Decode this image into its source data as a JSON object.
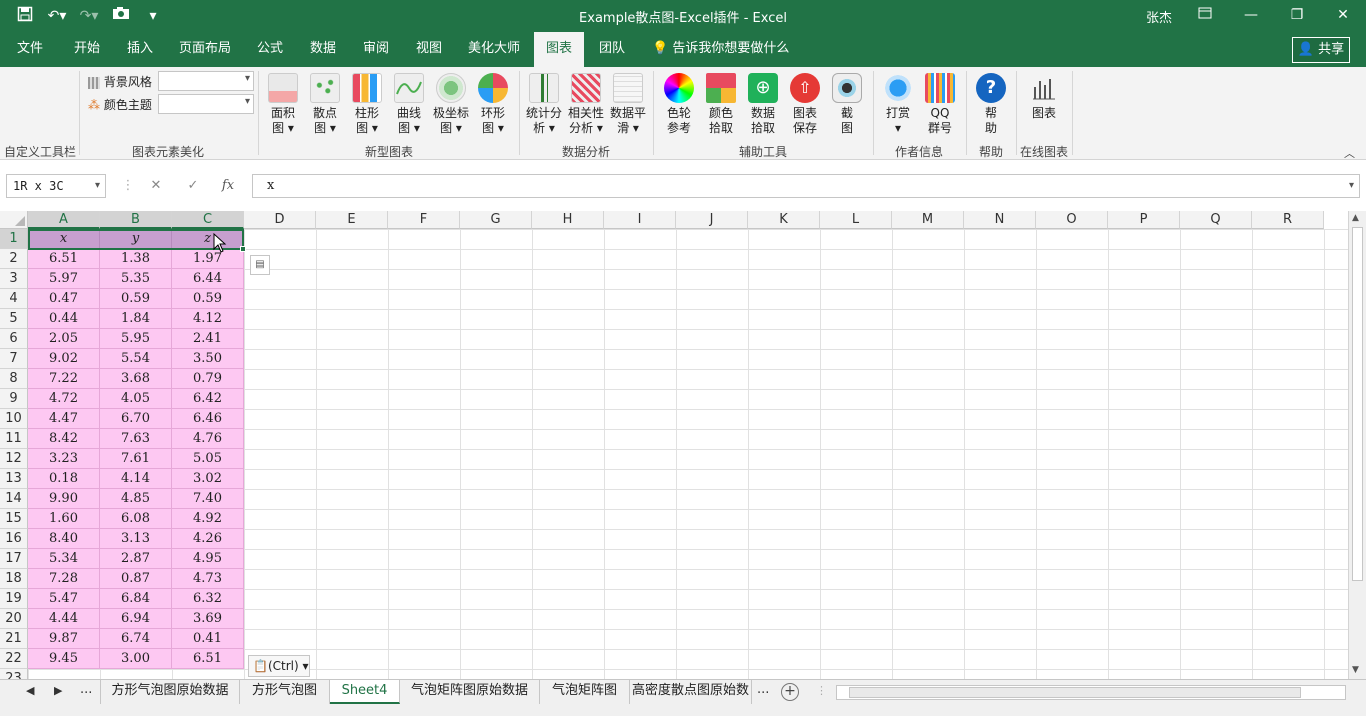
{
  "titlebar": {
    "title": "Example散点图-Excel插件 - Excel",
    "user": "张杰",
    "qat_icons": [
      "save-icon",
      "undo-icon",
      "redo-icon",
      "camera-icon",
      "customize-icon"
    ]
  },
  "tabs": [
    {
      "label": "文件",
      "active": false
    },
    {
      "label": "开始",
      "active": false
    },
    {
      "label": "插入",
      "active": false
    },
    {
      "label": "页面布局",
      "active": false
    },
    {
      "label": "公式",
      "active": false
    },
    {
      "label": "数据",
      "active": false
    },
    {
      "label": "审阅",
      "active": false
    },
    {
      "label": "视图",
      "active": false
    },
    {
      "label": "美化大师",
      "active": false
    },
    {
      "label": "图表",
      "active": true
    },
    {
      "label": "团队",
      "active": false
    }
  ],
  "tell_me": "告诉我你想要做什么",
  "share_label": "共享",
  "ribbon": {
    "groups": {
      "custom_toolbar": "自定义工具栏",
      "beautify": "图表元素美化",
      "new_chart": "新型图表",
      "analysis": "数据分析",
      "assist": "辅助工具",
      "author": "作者信息",
      "help": "帮助",
      "online": "在线图表"
    },
    "beautify": {
      "bg_style": "背景风格",
      "color_theme": "颜色主题"
    },
    "new_chart_buttons": [
      {
        "line1": "面积",
        "line2": "图 ▾"
      },
      {
        "line1": "散点",
        "line2": "图 ▾"
      },
      {
        "line1": "柱形",
        "line2": "图 ▾"
      },
      {
        "line1": "曲线",
        "line2": "图 ▾"
      },
      {
        "line1": "极坐标",
        "line2": "图 ▾"
      },
      {
        "line1": "环形",
        "line2": "图 ▾"
      }
    ],
    "analysis_buttons": [
      {
        "line1": "统计分",
        "line2": "析 ▾"
      },
      {
        "line1": "相关性",
        "line2": "分析 ▾"
      },
      {
        "line1": "数据平",
        "line2": "滑 ▾"
      }
    ],
    "assist_buttons": [
      {
        "line1": "色轮",
        "line2": "参考"
      },
      {
        "line1": "颜色",
        "line2": "拾取"
      },
      {
        "line1": "数据",
        "line2": "拾取"
      },
      {
        "line1": "图表",
        "line2": "保存"
      },
      {
        "line1": "截",
        "line2": "图"
      }
    ],
    "author_buttons": [
      {
        "line1": "打赏",
        "line2": "▾"
      },
      {
        "line1": "QQ",
        "line2": "群号"
      }
    ],
    "help_button": {
      "line1": "帮",
      "line2": "助"
    },
    "online_button": {
      "line1": "图表",
      "line2": ""
    }
  },
  "formula_bar": {
    "name_box": "1R x 3C",
    "cancel": "✕",
    "enter": "✓",
    "fx": "fx",
    "content": "x"
  },
  "columns": [
    "A",
    "B",
    "C",
    "D",
    "E",
    "F",
    "G",
    "H",
    "I",
    "J",
    "K",
    "L",
    "M",
    "N",
    "O",
    "P",
    "Q",
    "R"
  ],
  "rows": [
    "1",
    "2",
    "3",
    "4",
    "5",
    "6",
    "7",
    "8",
    "9",
    "10",
    "11",
    "12",
    "13",
    "14",
    "15",
    "16",
    "17",
    "18",
    "19",
    "20",
    "21",
    "22",
    "23"
  ],
  "table": {
    "headers": [
      "x",
      "y",
      "z"
    ],
    "values": [
      [
        "6.51",
        "1.38",
        "1.97"
      ],
      [
        "5.97",
        "5.35",
        "6.44"
      ],
      [
        "0.47",
        "0.59",
        "0.59"
      ],
      [
        "0.44",
        "1.84",
        "4.12"
      ],
      [
        "2.05",
        "5.95",
        "2.41"
      ],
      [
        "9.02",
        "5.54",
        "3.50"
      ],
      [
        "7.22",
        "3.68",
        "0.79"
      ],
      [
        "4.72",
        "4.05",
        "6.42"
      ],
      [
        "4.47",
        "6.70",
        "6.46"
      ],
      [
        "8.42",
        "7.63",
        "4.76"
      ],
      [
        "3.23",
        "7.61",
        "5.05"
      ],
      [
        "0.18",
        "4.14",
        "3.02"
      ],
      [
        "9.90",
        "4.85",
        "7.40"
      ],
      [
        "1.60",
        "6.08",
        "4.92"
      ],
      [
        "8.40",
        "3.13",
        "4.26"
      ],
      [
        "5.34",
        "2.87",
        "4.95"
      ],
      [
        "7.28",
        "0.87",
        "4.73"
      ],
      [
        "5.47",
        "6.84",
        "6.32"
      ],
      [
        "4.44",
        "6.94",
        "3.69"
      ],
      [
        "9.87",
        "6.74",
        "0.41"
      ],
      [
        "9.45",
        "3.00",
        "6.51"
      ]
    ]
  },
  "paste_options": "(Ctrl) ▾",
  "sheet_tabs": [
    {
      "label": "方形气泡图原始数据",
      "active": false
    },
    {
      "label": "方形气泡图",
      "active": false
    },
    {
      "label": "Sheet4",
      "active": true
    },
    {
      "label": "气泡矩阵图原始数据",
      "active": false
    },
    {
      "label": "气泡矩阵图",
      "active": false
    },
    {
      "label": "高密度散点图原始数",
      "active": false
    }
  ],
  "sheet_nav": {
    "prev": "◀",
    "next": "▶",
    "more": "...",
    "more_right": "...",
    "add": "+"
  },
  "colors": {
    "accent": "#217346",
    "header_fill": "#c79fcf",
    "data_fill": "#fdc8f2"
  }
}
